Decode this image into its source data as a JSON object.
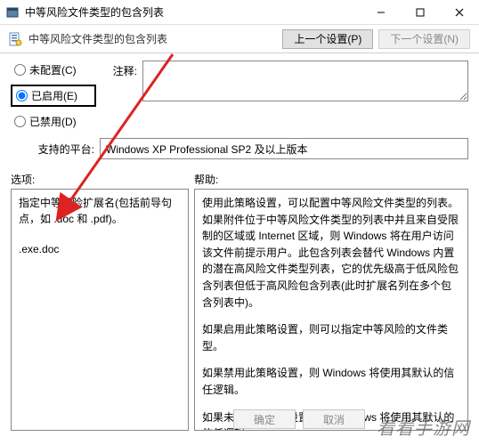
{
  "window": {
    "title": "中等风险文件类型的包含列表",
    "min_tooltip": "Minimize",
    "max_tooltip": "Maximize",
    "close_tooltip": "Close"
  },
  "subheader": {
    "title": "中等风险文件类型的包含列表",
    "prev_button": "上一个设置(P)",
    "next_button": "下一个设置(N)"
  },
  "config": {
    "radios": {
      "not_configured": "未配置(C)",
      "enabled": "已启用(E)",
      "disabled": "已禁用(D)"
    },
    "comment_label": "注释:",
    "comment_value": "",
    "platform_label": "支持的平台:",
    "platform_value": "Windows XP Professional SP2 及以上版本"
  },
  "sections": {
    "options_label": "选项:",
    "help_label": "帮助:"
  },
  "options_panel": {
    "description": "指定中等风险扩展名(包括前导句点，如 .doc 和 .pdf)。",
    "value": ".exe.doc"
  },
  "help_panel": {
    "p1": "使用此策略设置，可以配置中等风险文件类型的列表。如果附件位于中等风险文件类型的列表中并且来自受限制的区域或 Internet 区域，则 Windows 将在用户访问该文件前提示用户。此包含列表会替代 Windows 内置的潜在高风险文件类型列表，它的优先级高于低风险包含列表但低于高风险包含列表(此时扩展名列在多个包含列表中)。",
    "p2": "如果启用此策略设置，则可以指定中等风险的文件类型。",
    "p3": "如果禁用此策略设置，则 Windows 将使用其默认的信任逻辑。",
    "p4": "如果未配置此策略设置，则 Windows 将使用其默认的信任逻辑。"
  },
  "footer": {
    "ok": "确定",
    "cancel": "取消"
  },
  "watermark": "看看手游网"
}
